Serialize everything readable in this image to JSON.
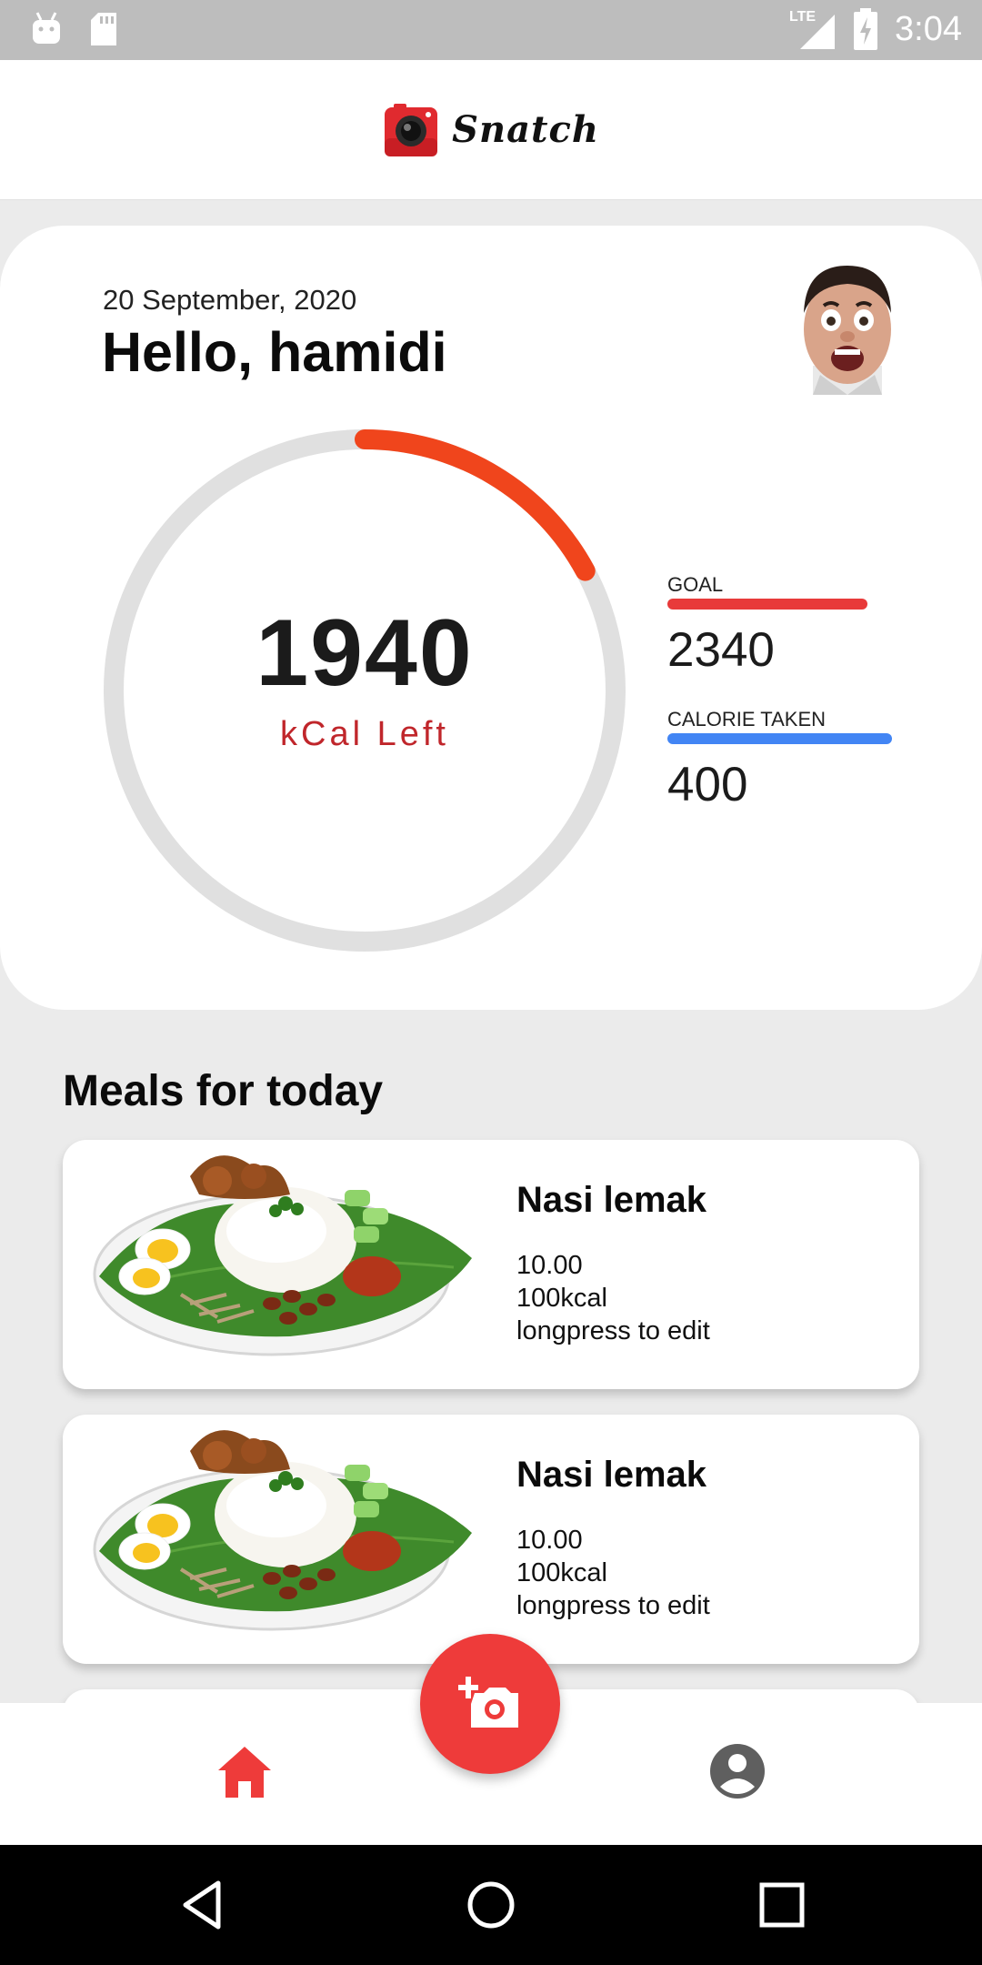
{
  "status_bar": {
    "time": "3:04",
    "network": "LTE",
    "icons": [
      "android-icon",
      "sd-card-icon",
      "signal-icon",
      "battery-charging-icon"
    ]
  },
  "app_bar": {
    "title": "Snatch",
    "logo_icon": "camera-logo-icon"
  },
  "summary": {
    "date": "20 September, 2020",
    "greeting": "Hello, hamidi",
    "avatar": "avatar",
    "kcal_left_value": "1940",
    "kcal_left_label": "kCal Left",
    "progress_fraction": 0.171,
    "goal_label": "GOAL",
    "goal_value": "2340",
    "taken_label": "CALORIE TAKEN",
    "taken_value": "400",
    "colors": {
      "ring_track": "#e0e0e0",
      "ring_progress": "#f0451c",
      "goal_bar": "#e83a3a",
      "taken_bar": "#4285f4"
    }
  },
  "meals": {
    "title": "Meals for today",
    "items": [
      {
        "name": "Nasi lemak",
        "price": "10.00",
        "calories": "100kcal",
        "hint": "longpress to edit"
      },
      {
        "name": "Nasi lemak",
        "price": "10.00",
        "calories": "100kcal",
        "hint": "longpress to edit"
      }
    ]
  },
  "bottom_nav": {
    "items": [
      "home-icon",
      "profile-icon"
    ],
    "fab_icon": "add-photo-icon",
    "active_color": "#ee3b3a"
  },
  "system_nav": [
    "back-icon",
    "home-circle-icon",
    "recents-icon"
  ]
}
